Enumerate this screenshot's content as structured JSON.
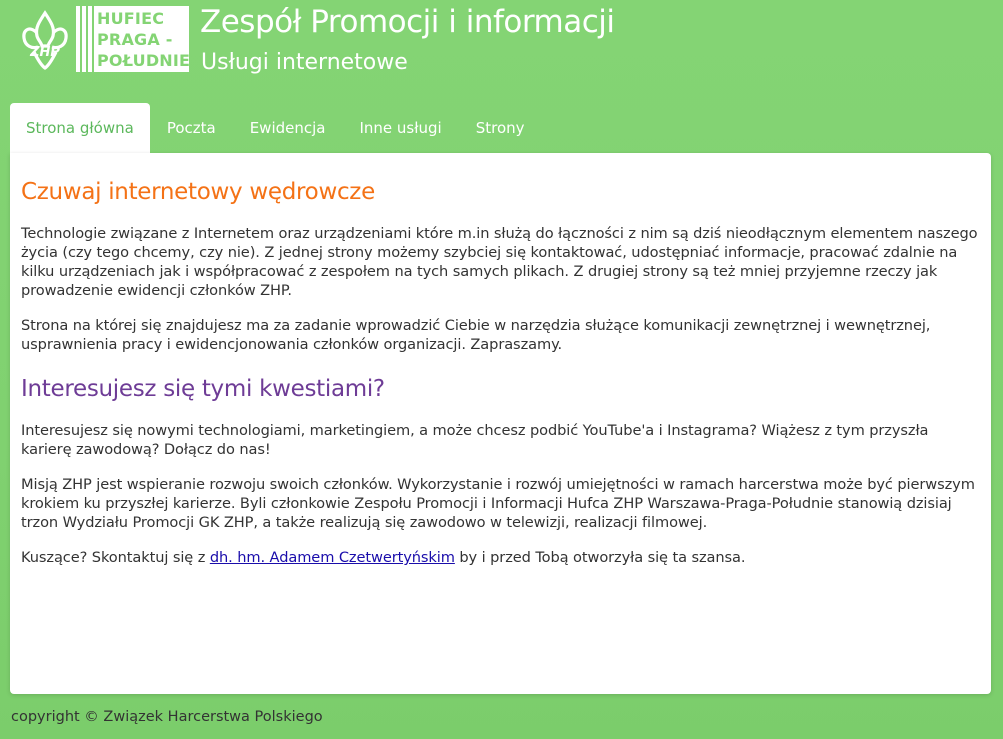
{
  "logo": {
    "zhp_icon": "zhp-lily-emblem",
    "hufiec_lines": [
      "HUFIEC",
      "PRAGA -",
      "POŁUDNIE"
    ]
  },
  "header": {
    "title": "Zespół Promocji i informacji",
    "subtitle": "Usługi internetowe"
  },
  "tabs": [
    {
      "label": "Strona główna",
      "active": true
    },
    {
      "label": "Poczta",
      "active": false
    },
    {
      "label": "Ewidencja",
      "active": false
    },
    {
      "label": "Inne usługi",
      "active": false
    },
    {
      "label": "Strony",
      "active": false
    }
  ],
  "content": {
    "heading1": "Czuwaj internetowy wędrowcze",
    "para1": "Technologie związane z Internetem oraz urządzeniami które m.in służą do łączności z nim są dziś nieodłącznym elementem naszego życia (czy tego chcemy, czy nie). Z jednej strony możemy szybciej się kontaktować, udostępniać informacje, pracować zdalnie na kilku urządzeniach jak i współpracować z zespołem na tych samych plikach. Z drugiej strony są też mniej przyjemne rzeczy jak prowadzenie ewidencji członków ZHP.",
    "para2": "Strona na której się znajdujesz ma za zadanie wprowadzić Ciebie w narzędzia służące komunikacji zewnętrznej i wewnętrznej, usprawnienia pracy i ewidencjonowania członków organizacji. Zapraszamy.",
    "heading2": "Interesujesz się tymi kwestiami?",
    "para3": "Interesujesz się nowymi technologiami, marketingiem, a może chcesz podbić YouTube'a i Instagrama? Wiążesz z tym przyszła karierę zawodową? Dołącz do nas!",
    "para4": "Misją ZHP jest wspieranie rozwoju swoich członków. Wykorzystanie i rozwój umiejętności w ramach harcerstwa może być pierwszym krokiem ku przyszłej karierze. Byli członkowie Zespołu Promocji i Informacji Hufca ZHP Warszawa-Praga-Południe stanowią dzisiaj trzon Wydziału Promocji GK ZHP, a także realizują się zawodowo w telewizji, realizacji filmowej.",
    "para5_before": "Kuszące? Skontaktuj się z ",
    "para5_link": "dh. hm. Adamem Czetwertyńskim",
    "para5_after": " by i przed Tobą otworzyła się ta szansa."
  },
  "footer": {
    "text": "copyright © Związek Harcerstwa Polskiego"
  },
  "colors": {
    "background": "#84d474",
    "heading_orange": "#f47216",
    "heading_purple": "#6e3c96",
    "active_tab_text": "#5cb85c",
    "link": "#1a0dab"
  }
}
